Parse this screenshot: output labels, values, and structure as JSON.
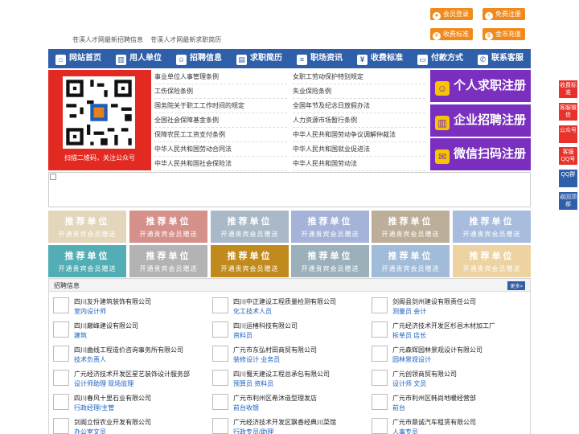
{
  "top": {
    "links": [
      "苍溪人才网最新招聘信息",
      "苍溪人才网最新求职简历"
    ],
    "buttons": [
      {
        "label": "会员登录",
        "icon": "user-icon"
      },
      {
        "label": "免费注册",
        "icon": "register-icon"
      },
      {
        "label": "收费标准",
        "icon": "yen-icon"
      },
      {
        "label": "金币充值",
        "icon": "coin-icon"
      }
    ]
  },
  "nav": [
    {
      "label": "网站首页",
      "icon": "home-icon"
    },
    {
      "label": "用人单位",
      "icon": "building-icon"
    },
    {
      "label": "招聘信息",
      "icon": "people-icon"
    },
    {
      "label": "求职简历",
      "icon": "resume-icon"
    },
    {
      "label": "职场资讯",
      "icon": "news-icon"
    },
    {
      "label": "收费标准",
      "icon": "fee-icon"
    },
    {
      "label": "付款方式",
      "icon": "payment-icon"
    },
    {
      "label": "联系客服",
      "icon": "phone-icon"
    }
  ],
  "qr": {
    "caption": "扫描二维码，关注公众号"
  },
  "links_left": [
    "事业单位人事管理条例",
    "工伤保险条例",
    "国务院关于职工工作时间的规定",
    "全国社会保障基金条例",
    "保障农民工工资支付条例",
    "中华人民共和国劳动合同法",
    "中华人民共和国社会保险法"
  ],
  "links_right": [
    "女职工劳动保护特别规定",
    "失业保险条例",
    "全国年节及纪念日放假办法",
    "人力资源市场暂行条例",
    "中华人民共和国劳动争议调解仲裁法",
    "中华人民共和国就业促进法",
    "中华人民共和国劳动法"
  ],
  "register": [
    {
      "label": "个人求职注册",
      "icon": "person-icon"
    },
    {
      "label": "企业招聘注册",
      "icon": "company-icon"
    },
    {
      "label": "微信扫码注册",
      "icon": "wechat-icon"
    }
  ],
  "recommend": {
    "title": "推荐单位",
    "subtitle": "开通贵宾会员赠送",
    "colors": [
      "#e3d6bb",
      "#d49089",
      "#a9b9c8",
      "#a6b3d9",
      "#bcae98",
      "#a8bcde",
      "#52adb4",
      "#b3b3b3",
      "#c08a1c",
      "#9bb0bb",
      "#a0bcd9",
      "#ecd3a1"
    ]
  },
  "jobs": {
    "title": "招聘信息",
    "more": "更多>",
    "items": [
      {
        "company": "四川友升建筑装饰有限公司",
        "positions": "室内设计师"
      },
      {
        "company": "四川中正建设工程质量检测有限公司",
        "positions": "化工技术人员"
      },
      {
        "company": "剑阁县剑州建设有限责任公司",
        "positions": "测量员  会计"
      },
      {
        "company": "四川巅峰建设有限公司",
        "positions": "建筑"
      },
      {
        "company": "四川运椿科技有限公司",
        "positions": "资料员"
      },
      {
        "company": "广元经济技术开发区杉邑木材加工厂",
        "positions": "拆单员  店长"
      },
      {
        "company": "四川曲线工程造价咨询事务所有限公司",
        "positions": "技术负责人"
      },
      {
        "company": "广元市东弘村田商贸有限公司",
        "positions": "装修设计  业务员"
      },
      {
        "company": "广元森辉园林景观设计有限公司",
        "positions": "园林景观设计"
      },
      {
        "company": "广元经济技术开发区星艺装饰设计服务部",
        "positions": "设计师助理  现场监理"
      },
      {
        "company": "四川蜀天建设工程总承包有限公司",
        "positions": "预算员  资料员"
      },
      {
        "company": "广元创领商贸有限公司",
        "positions": "设计师  文员"
      },
      {
        "company": "四川春风十里石业有限公司",
        "positions": "行政经理/主管"
      },
      {
        "company": "广元市利州区希沐造型理发店",
        "positions": "前台收银"
      },
      {
        "company": "广元市利州区韩尚地暖经营部",
        "positions": "前台"
      },
      {
        "company": "剑阁立恒农业开发有限公司",
        "positions": "办公室文员"
      },
      {
        "company": "广元经济技术开发区飘香经典川菜馆",
        "positions": "行政专员/助理"
      },
      {
        "company": "广元市鼎诚汽车租赁有限公司",
        "positions": "人事专员"
      }
    ]
  },
  "side": [
    {
      "label": "收费标准",
      "color": "#e8312a"
    },
    {
      "label": "客服微信",
      "color": "#e8312a"
    },
    {
      "label": "公众号",
      "color": "#e8312a"
    },
    {
      "label": "客服QQ号",
      "color": "#e8312a"
    },
    {
      "label": "QQ群",
      "color": "#2f5fa8"
    },
    {
      "label": "返回顶部",
      "color": "#2f5fa8"
    }
  ]
}
